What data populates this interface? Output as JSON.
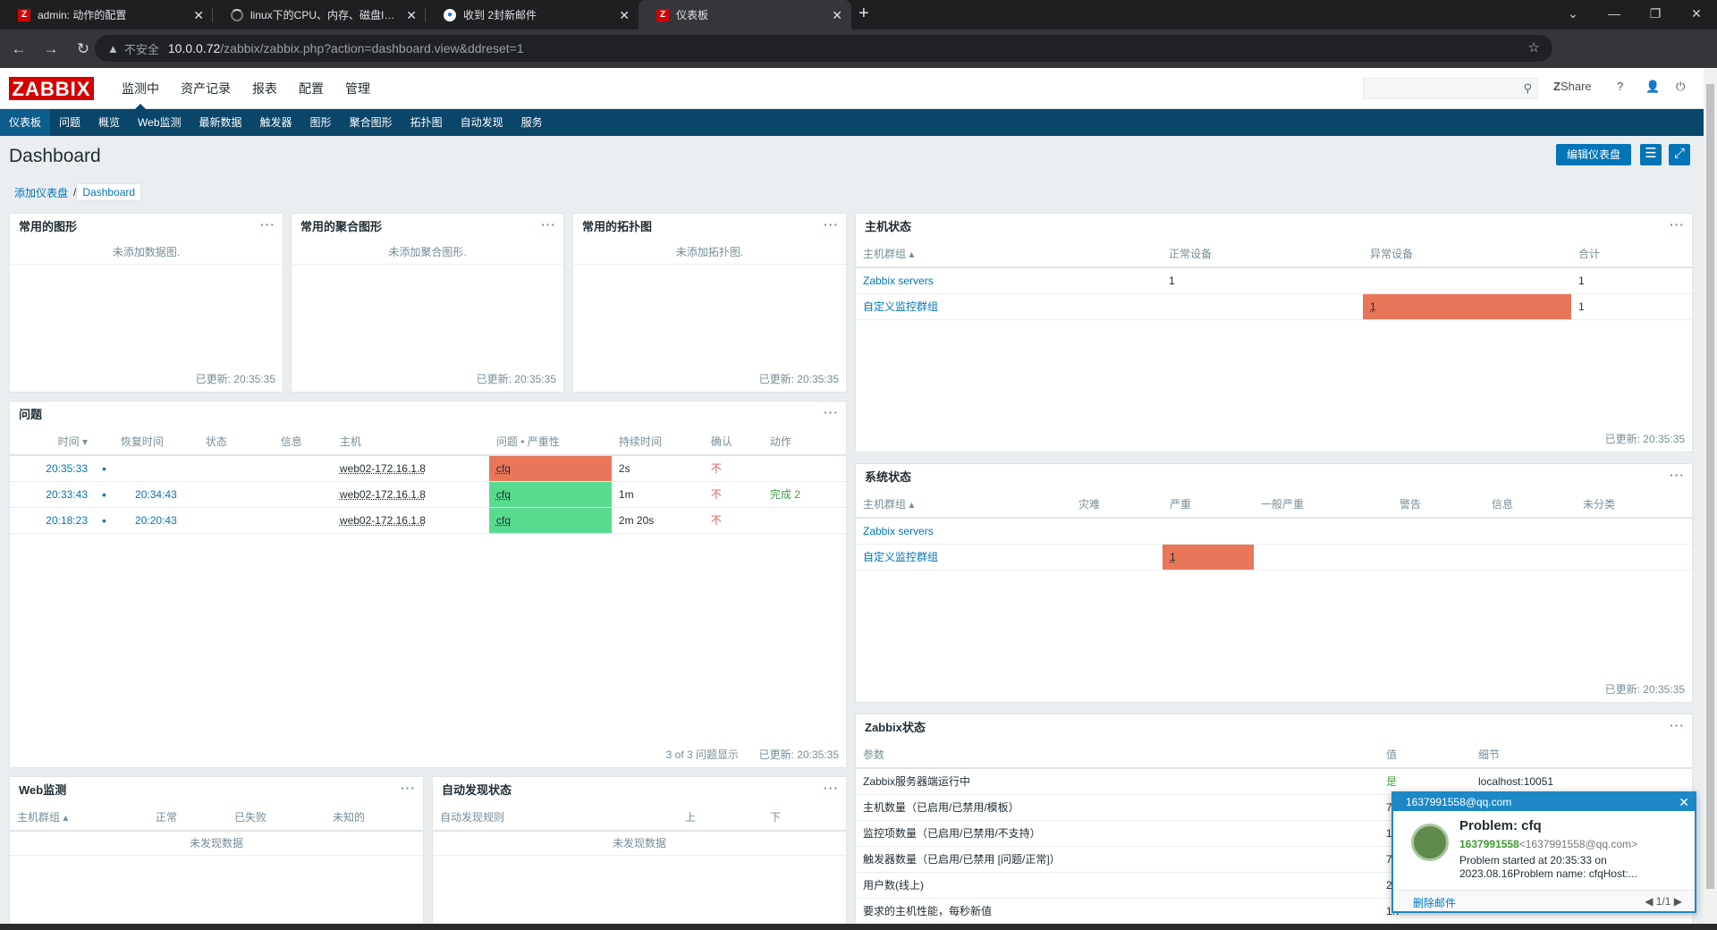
{
  "browser": {
    "tabs": [
      {
        "title": "admin: 动作的配置",
        "favicon": "zabbix-favicon"
      },
      {
        "title": "linux下的CPU、内存、磁盘IO、",
        "favicon": "loading-favicon"
      },
      {
        "title": "收到 2封新邮件",
        "favicon": "mail-favicon"
      },
      {
        "title": "仪表板",
        "favicon": "zabbix-favicon"
      }
    ],
    "insecure_label": "不安全",
    "url_host": "10.0.0.72",
    "url_path": "/zabbix/zabbix.php?action=dashboard.view&ddreset=1"
  },
  "header": {
    "logo": "ZABBIX",
    "menu": [
      "监测中",
      "资产记录",
      "报表",
      "配置",
      "管理"
    ],
    "share": "Share",
    "help": "?"
  },
  "submenu": [
    "仪表板",
    "问题",
    "概览",
    "Web监测",
    "最新数据",
    "触发器",
    "图形",
    "聚合图形",
    "拓扑图",
    "自动发现",
    "服务"
  ],
  "page": {
    "title": "Dashboard",
    "edit_button": "编辑仪表盘",
    "breadcrumb_root": "添加仪表盘",
    "breadcrumb_sep": "/",
    "breadcrumb_current": "Dashboard"
  },
  "fav_graphs": {
    "title": "常用的图形",
    "empty": "未添加数据图.",
    "updated": "已更新: 20:35:35"
  },
  "fav_screens": {
    "title": "常用的聚合图形",
    "empty": "未添加聚合图形.",
    "updated": "已更新: 20:35:35"
  },
  "fav_maps": {
    "title": "常用的拓扑图",
    "empty": "未添加拓扑图.",
    "updated": "已更新: 20:35:35"
  },
  "problems": {
    "title": "问题",
    "columns": [
      "时间 ▾",
      "恢复时间",
      "状态",
      "信息",
      "主机",
      "问题 • 严重性",
      "持续时间",
      "确认",
      "动作"
    ],
    "rows": [
      {
        "time": "20:35:33",
        "recovery": "",
        "host": "web02-172.16.1.8",
        "problem": "cfq",
        "severity_color": "#e97659",
        "duration": "2s",
        "ack": "不",
        "action": ""
      },
      {
        "time": "20:33:43",
        "recovery": "20:34:43",
        "host": "web02-172.16.1.8",
        "problem": "cfq",
        "severity_color": "#59db8f",
        "duration": "1m",
        "ack": "不",
        "action": "完成 2"
      },
      {
        "time": "20:18:23",
        "recovery": "20:20:43",
        "host": "web02-172.16.1.8",
        "problem": "cfq",
        "severity_color": "#59db8f",
        "duration": "2m 20s",
        "ack": "不",
        "action": ""
      }
    ],
    "count_text": "3 of 3 问题显示",
    "updated": "已更新: 20:35:35"
  },
  "web_monitoring": {
    "title": "Web监测",
    "columns": [
      "主机群组 ▴",
      "正常",
      "已失败",
      "未知的"
    ],
    "empty": "未发现数据"
  },
  "discovery": {
    "title": "自动发现状态",
    "columns": [
      "自动发现规则",
      "上",
      "下"
    ],
    "empty": "未发现数据"
  },
  "host_status": {
    "title": "主机状态",
    "columns": [
      "主机群组 ▴",
      "正常设备",
      "异常设备",
      "合计"
    ],
    "rows": [
      {
        "group": "Zabbix servers",
        "ok": "1",
        "problem": "",
        "total": "1"
      },
      {
        "group": "自定义监控群组",
        "ok": "",
        "problem": "1",
        "total": "1"
      }
    ],
    "updated": "已更新: 20:35:35"
  },
  "system_status": {
    "title": "系统状态",
    "columns": [
      "主机群组 ▴",
      "灾难",
      "严重",
      "一般严重",
      "警告",
      "信息",
      "未分类"
    ],
    "rows": [
      {
        "group": "Zabbix servers",
        "high": ""
      },
      {
        "group": "自定义监控群组",
        "high": "1"
      }
    ],
    "updated": "已更新: 20:35:35"
  },
  "zabbix_status": {
    "title": "Zabbix状态",
    "columns": [
      "参数",
      "值",
      "细节"
    ],
    "rows": [
      {
        "param": "Zabbix服务器端运行中",
        "value": "是",
        "detail": "localhost:10051"
      },
      {
        "param": "主机数量（已启用/已禁用/模板）",
        "value": "7",
        "detail": ""
      },
      {
        "param": "监控项数量（已启用/已禁用/不支持）",
        "value": "1",
        "detail": ""
      },
      {
        "param": "触发器数量（已启用/已禁用 [问题/正常]）",
        "value": "7",
        "detail": ""
      },
      {
        "param": "用户数(线上)",
        "value": "2",
        "detail": ""
      },
      {
        "param": "要求的主机性能，每秒新值",
        "value": "1.7",
        "detail": ""
      }
    ]
  },
  "mail_popup": {
    "sender_header": "1637991558@qq.com",
    "subject": "Problem: cfq",
    "from_name": "1637991558",
    "from_addr": "<1637991558@qq.com>",
    "body": "Problem started at 20:35:33 on 2023.08.16Problem name: cfqHost:...",
    "delete": "删除邮件",
    "page": "1/1"
  }
}
